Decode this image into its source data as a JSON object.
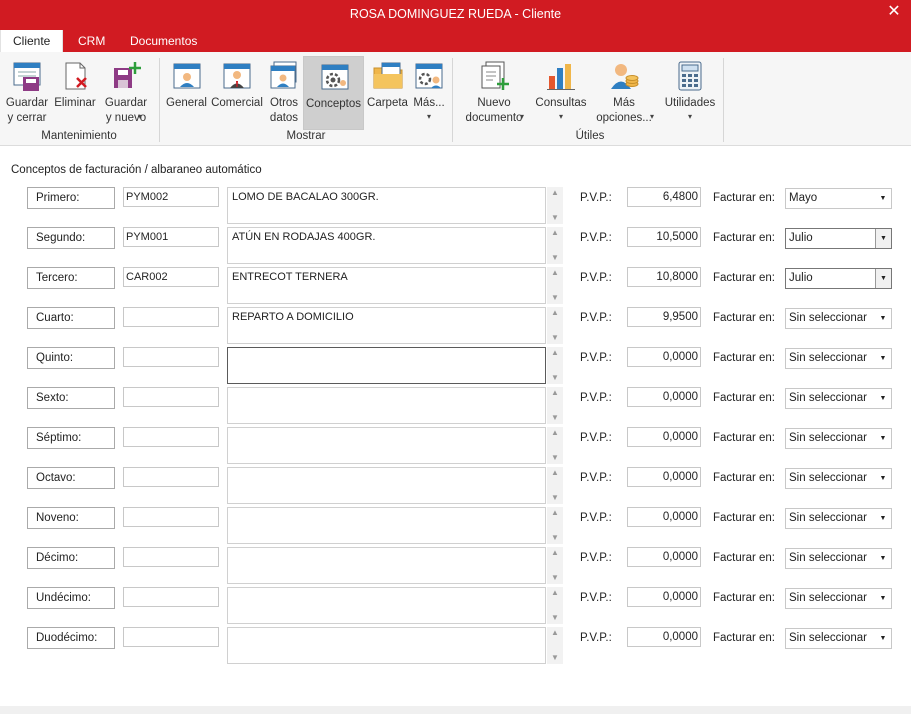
{
  "window": {
    "title": "ROSA DOMINGUEZ RUEDA - Cliente",
    "close_label": "✕"
  },
  "tabs": [
    {
      "label": "Cliente"
    },
    {
      "label": "CRM"
    },
    {
      "label": "Documentos"
    }
  ],
  "ribbon": {
    "buttons": [
      {
        "label": "Guardar\ny cerrar",
        "icon": "save-close-icon"
      },
      {
        "label": "Eliminar",
        "icon": "delete-icon"
      },
      {
        "label": "Guardar\ny nuevo",
        "icon": "save-new-icon",
        "dropdown": "▾"
      },
      {
        "label": "General",
        "icon": "general-card-icon"
      },
      {
        "label": "Comercial",
        "icon": "sales-person-icon"
      },
      {
        "label": "Otros\ndatos",
        "icon": "other-data-icon"
      },
      {
        "label": "Conceptos",
        "icon": "concepts-gear-icon"
      },
      {
        "label": "Carpeta",
        "icon": "folder-icon"
      },
      {
        "label": "Más...",
        "icon": "more-gear-icon",
        "dropdown": "▾"
      },
      {
        "label": "Nuevo\ndocumento",
        "icon": "new-document-icon",
        "dropdown": "▾"
      },
      {
        "label": "Consultas",
        "icon": "bar-chart-icon",
        "dropdown": "▾"
      },
      {
        "label": "Más\nopciones...",
        "icon": "user-coins-icon",
        "dropdown": "▾"
      },
      {
        "label": "Utilidades",
        "icon": "calculator-icon",
        "dropdown": "▾"
      }
    ],
    "groups": [
      {
        "label": "Mantenimiento"
      },
      {
        "label": "Mostrar"
      },
      {
        "label": "Útiles"
      }
    ]
  },
  "section_title": "Conceptos de facturación / albaraneo automático",
  "pvp_label": "P.V.P.:",
  "facturar_label": "Facturar en:",
  "rows": [
    {
      "label": "Primero:",
      "code": "PYM002",
      "description": "LOMO DE BACALAO 300GR.",
      "price": "6,4800",
      "month": "Mayo"
    },
    {
      "label": "Segundo:",
      "code": "PYM001",
      "description": "ATÚN EN RODAJAS 400GR.",
      "price": "10,5000",
      "month": "Julio"
    },
    {
      "label": "Tercero:",
      "code": "CAR002",
      "description": "ENTRECOT TERNERA",
      "price": "10,8000",
      "month": "Julio"
    },
    {
      "label": "Cuarto:",
      "code": "",
      "description": "REPARTO A DOMICILIO",
      "price": "9,9500",
      "month": "Sin seleccionar"
    },
    {
      "label": "Quinto:",
      "code": "",
      "description": "",
      "price": "0,0000",
      "month": "Sin seleccionar"
    },
    {
      "label": "Sexto:",
      "code": "",
      "description": "",
      "price": "0,0000",
      "month": "Sin seleccionar"
    },
    {
      "label": "Séptimo:",
      "code": "",
      "description": "",
      "price": "0,0000",
      "month": "Sin seleccionar"
    },
    {
      "label": "Octavo:",
      "code": "",
      "description": "",
      "price": "0,0000",
      "month": "Sin seleccionar"
    },
    {
      "label": "Noveno:",
      "code": "",
      "description": "",
      "price": "0,0000",
      "month": "Sin seleccionar"
    },
    {
      "label": "Décimo:",
      "code": "",
      "description": "",
      "price": "0,0000",
      "month": "Sin seleccionar"
    },
    {
      "label": "Undécimo:",
      "code": "",
      "description": "",
      "price": "0,0000",
      "month": "Sin seleccionar"
    },
    {
      "label": "Duodécimo:",
      "code": "",
      "description": "",
      "price": "0,0000",
      "month": "Sin seleccionar"
    }
  ],
  "scroll_up": "▲",
  "scroll_down": "▼",
  "select_arrow": "▼",
  "colors": {
    "title_bar": "#d11b22",
    "ribbon_bg": "#f6f6f6",
    "selected_button": "#cfcfcf"
  }
}
